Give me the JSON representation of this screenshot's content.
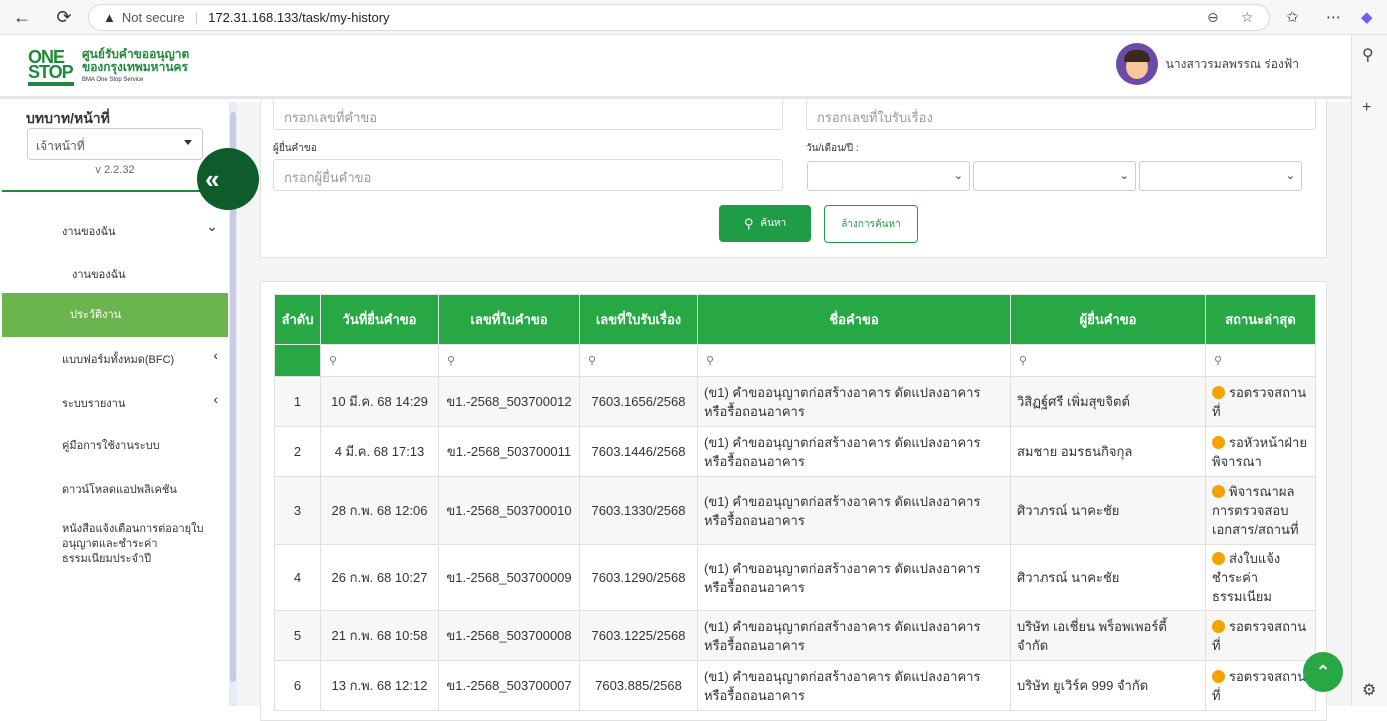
{
  "browser": {
    "back": "←",
    "reload": "⟳",
    "warning_icon": "▲",
    "not_secure": "Not secure",
    "url": "172.31.168.133/task/my-history"
  },
  "header": {
    "logo_mark_1": "ONE",
    "logo_mark_2": "STOP",
    "logo_line1": "ศูนย์รับคำขออนุญาต",
    "logo_line2": "ของกรุงเทพมหานคร",
    "logo_line3": "BMA One Stop Service",
    "user_name": "นางสาวรมลพรรณ ร่องฟ้า"
  },
  "sidebar": {
    "role_title": "บทบาท/หน้าที่",
    "role_value": "เจ้าหน้าที่",
    "version": "v 2.2.32",
    "collapse_icon": "«",
    "items": [
      {
        "label": "งานของฉัน",
        "chev": "⌄"
      },
      {
        "label": "งานของฉัน"
      },
      {
        "label": "ประวัติงาน"
      },
      {
        "label": "แบบฟอร์มทั้งหมด(BFC)",
        "chev": "‹"
      },
      {
        "label": "ระบบรายงาน",
        "chev": "‹"
      },
      {
        "label": "คู่มือการใช้งานระบบ"
      },
      {
        "label": "ดาวน์โหลดแอปพลิเคชัน"
      },
      {
        "label": "หนังสือแจ้งเตือนการต่ออายุใบอนุญาตและชำระค่าธรรมเนียมประจำปี"
      }
    ]
  },
  "search": {
    "request_no_placeholder": "กรอกเลขที่คำขอ",
    "receipt_no_placeholder": "กรอกเลขที่ใบรับเรื่อง",
    "applicant_label": "ผู้ยื่นคำขอ",
    "applicant_placeholder": "กรอกผู้ยื่นคำขอ",
    "date_label": "วัน/เดือน/ปี :",
    "search_icon": "⚲",
    "search_button": "ค้นหา",
    "clear_button": "ล้างการค้นหา"
  },
  "table": {
    "headers": [
      "ลำดับ",
      "วันที่ยื่นคำขอ",
      "เลขที่ใบคำขอ",
      "เลขที่ใบรับเรื่อง",
      "ชื่อคำขอ",
      "ผู้ยื่นคำขอ",
      "สถานะล่าสุด"
    ],
    "filter_icon": "⚲",
    "rows": [
      {
        "no": "1",
        "date": "10 มี.ค. 68 14:29",
        "req_no": "ข1.-2568_503700012",
        "receipt": "7603.1656/2568",
        "name": "(ข1) คำขออนุญาตก่อสร้างอาคาร ดัดแปลงอาคาร หรือรื้อถอนอาคาร",
        "applicant": "วิสิฏฐ์ศรี เพิ่มสุขจิตต์",
        "status": "รอตรวจสถานที่"
      },
      {
        "no": "2",
        "date": "4 มี.ค. 68 17:13",
        "req_no": "ข1.-2568_503700011",
        "receipt": "7603.1446/2568",
        "name": "(ข1) คำขออนุญาตก่อสร้างอาคาร ดัดแปลงอาคาร หรือรื้อถอนอาคาร",
        "applicant": "สมชาย อมรธนกิจกุล",
        "status": "รอหัวหน้าฝ่ายพิจารณา"
      },
      {
        "no": "3",
        "date": "28 ก.พ. 68 12:06",
        "req_no": "ข1.-2568_503700010",
        "receipt": "7603.1330/2568",
        "name": "(ข1) คำขออนุญาตก่อสร้างอาคาร ดัดแปลงอาคาร หรือรื้อถอนอาคาร",
        "applicant": "ศิวาภรณ์ นาคะชัย",
        "status": "พิจารณาผลการตรวจสอบเอกสาร/สถานที่"
      },
      {
        "no": "4",
        "date": "26 ก.พ. 68 10:27",
        "req_no": "ข1.-2568_503700009",
        "receipt": "7603.1290/2568",
        "name": "(ข1) คำขออนุญาตก่อสร้างอาคาร ดัดแปลงอาคาร หรือรื้อถอนอาคาร",
        "applicant": "ศิวาภรณ์ นาคะชัย",
        "status": "ส่งใบแจ้งชำระค่าธรรมเนียม"
      },
      {
        "no": "5",
        "date": "21 ก.พ. 68 10:58",
        "req_no": "ข1.-2568_503700008",
        "receipt": "7603.1225/2568",
        "name": "(ข1) คำขออนุญาตก่อสร้างอาคาร ดัดแปลงอาคาร หรือรื้อถอนอาคาร",
        "applicant": "บริษัท เอเชี่ยน พร็อพเพอร์ตี้ จำกัด",
        "status": "รอตรวจสถานที่"
      },
      {
        "no": "6",
        "date": "13 ก.พ. 68 12:12",
        "req_no": "ข1.-2568_503700007",
        "receipt": "7603.885/2568",
        "name": "(ข1) คำขออนุญาตก่อสร้างอาคาร ดัดแปลงอาคาร หรือรื้อถอนอาคาร",
        "applicant": "บริษัท ยูเวิร์ค 999 จำกัด",
        "status": "รอตรวจสถานที่"
      }
    ]
  },
  "scroll_top_icon": "⌃",
  "colors": {
    "primary": "#28a745",
    "sidebar_active": "#6cb54e",
    "status_dot": "#f5a300"
  }
}
